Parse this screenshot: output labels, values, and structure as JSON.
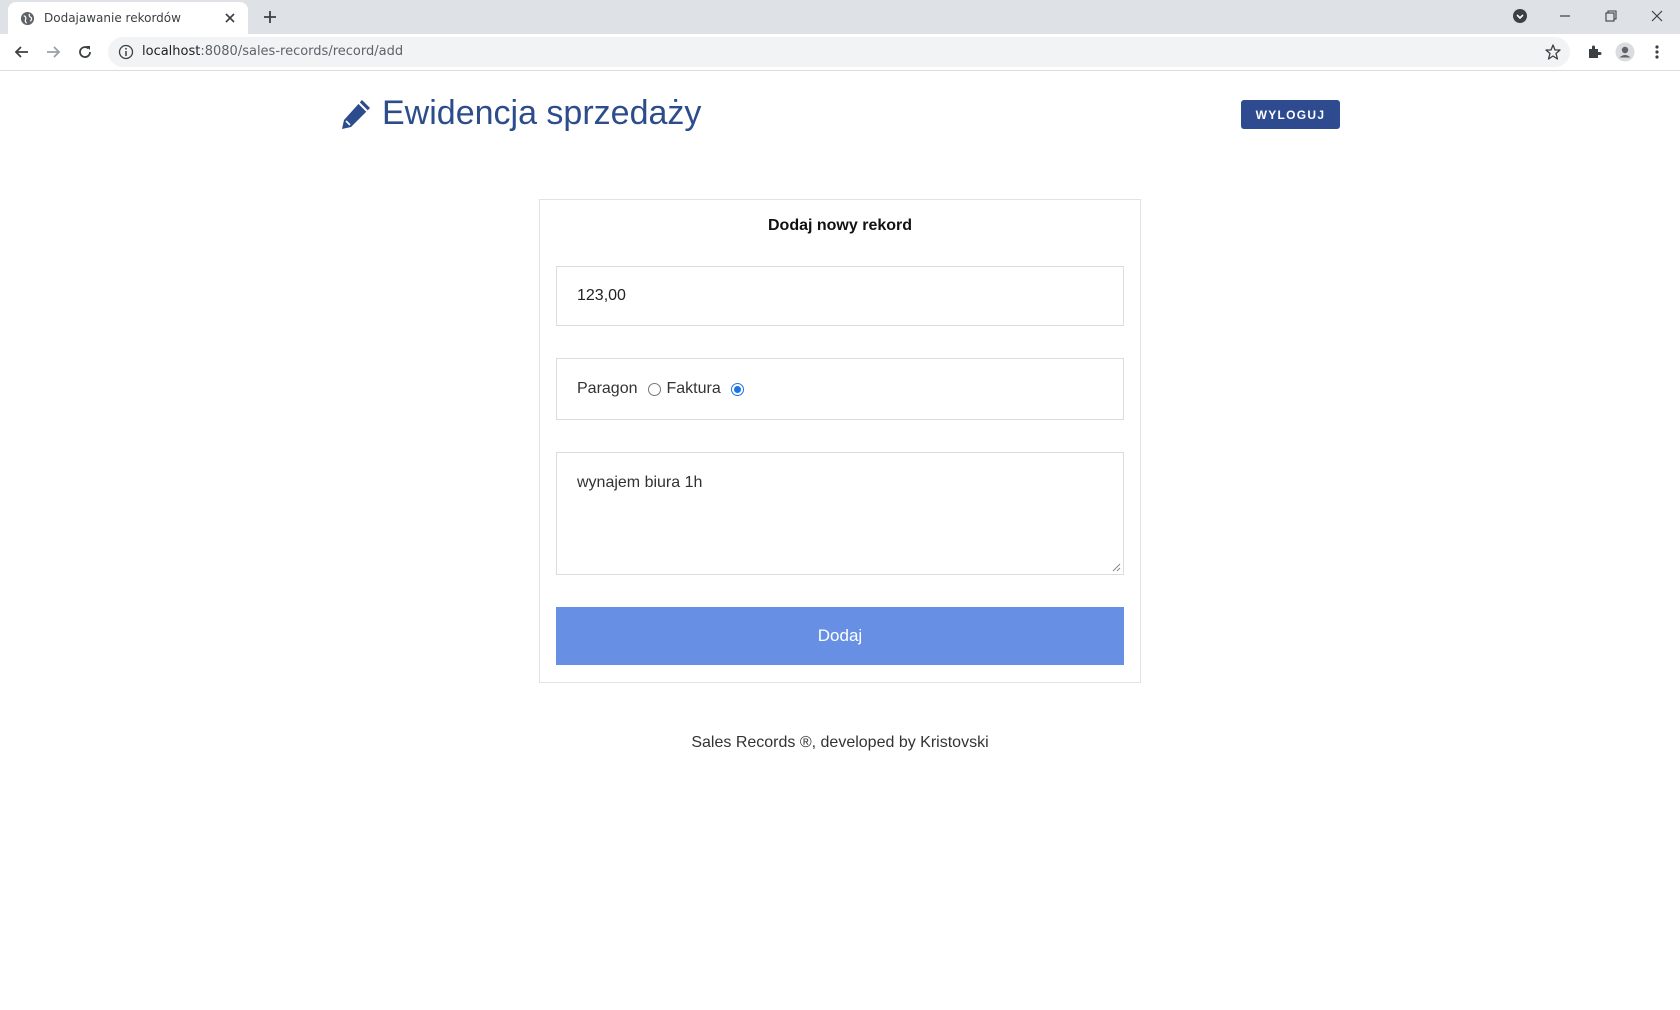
{
  "browser": {
    "tab_title": "Dodajawanie rekordów",
    "url_host": "localhost",
    "url_path": ":8080/sales-records/record/add"
  },
  "header": {
    "title": "Ewidencja sprzedaży",
    "logout_label": "WYLOGUJ"
  },
  "form": {
    "title": "Dodaj nowy rekord",
    "amount_value": "123,00",
    "radio_paragon_label": "Paragon",
    "radio_faktura_label": "Faktura",
    "selected_type": "Faktura",
    "description_value": "wynajem biura 1h",
    "submit_label": "Dodaj"
  },
  "footer": {
    "text": "Sales Records ®, developed by Kristovski"
  },
  "colors": {
    "brand": "#2c4c8c",
    "submit": "#6790e4"
  }
}
